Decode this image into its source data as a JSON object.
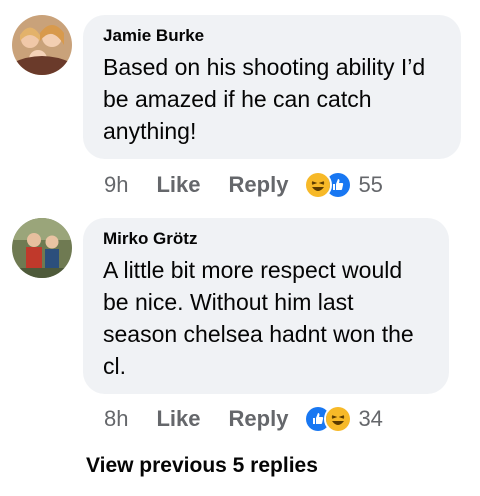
{
  "comments": [
    {
      "author": "Jamie Burke",
      "text": "Based on his shooting ability I’d be amazed if he can catch anything!",
      "time": "9h",
      "like_label": "Like",
      "reply_label": "Reply",
      "reaction_count": "55",
      "reactions": [
        "haha-icon",
        "like-icon"
      ]
    },
    {
      "author": "Mirko Grötz",
      "text": "A little bit more respect would be nice.  Without him last season chelsea hadnt won the cl.",
      "time": "8h",
      "like_label": "Like",
      "reply_label": "Reply",
      "reaction_count": "34",
      "reactions": [
        "like-icon",
        "haha-icon"
      ]
    }
  ],
  "view_previous_label": "View previous 5 replies",
  "colors": {
    "bubble": "#f0f2f5",
    "secondary_text": "#65676b",
    "like_blue": "#1877f2",
    "haha_yellow": "#f7b928"
  }
}
